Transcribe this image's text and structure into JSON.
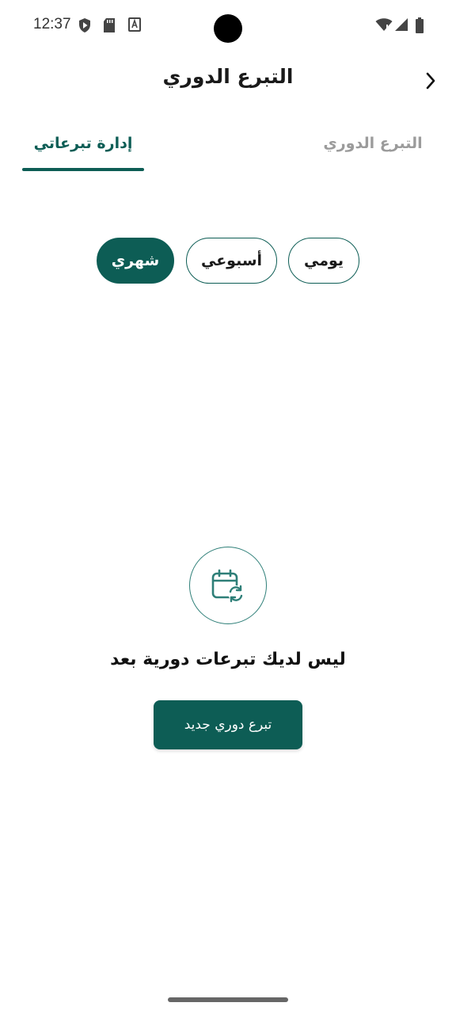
{
  "status_bar": {
    "time": "12:37",
    "icons": [
      "shield-play-icon",
      "sd-card-icon",
      "keyboard-a-icon",
      "wifi-icon",
      "signal-icon",
      "battery-icon"
    ]
  },
  "header": {
    "title": "التبرع الدوري",
    "back_icon": "chevron-right-icon"
  },
  "tabs": [
    {
      "label": "إدارة تبرعاتي",
      "active": true
    },
    {
      "label": "التبرع الدوري",
      "active": false
    }
  ],
  "frequency_filters": [
    {
      "label": "يومي",
      "selected": false
    },
    {
      "label": "أسبوعي",
      "selected": false
    },
    {
      "label": "شهري",
      "selected": true
    }
  ],
  "empty_state": {
    "icon": "calendar-repeat-icon",
    "message": "ليس لديك تبرعات دورية بعد",
    "button_label": "تبرع دوري جديد"
  },
  "colors": {
    "accent": "#0d5d55",
    "inactive_tab": "#9b9b9b"
  }
}
